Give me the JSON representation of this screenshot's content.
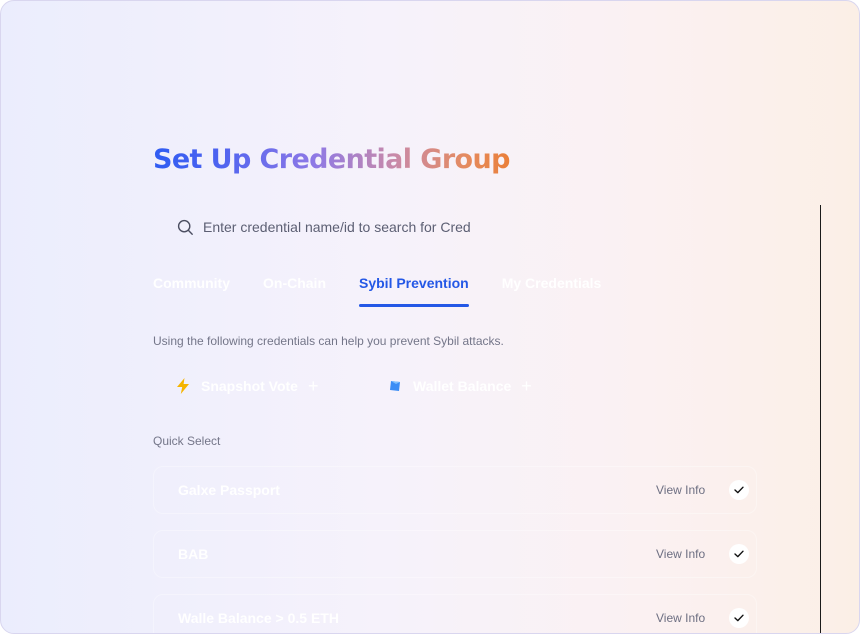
{
  "page": {
    "title": "Set Up Credential Group"
  },
  "search": {
    "placeholder": "Enter credential name/id to search for Cred"
  },
  "tabs": [
    {
      "label": "Community",
      "active": false
    },
    {
      "label": "On-Chain",
      "active": false
    },
    {
      "label": "Sybil Prevention",
      "active": true
    },
    {
      "label": "My Credentials",
      "active": false
    }
  ],
  "description": "Using the following credentials can help you prevent Sybil attacks.",
  "suggested": [
    {
      "label": "Snapshot Vote",
      "icon": "lightning-icon",
      "plus": "+"
    },
    {
      "label": "Wallet Balance",
      "icon": "cube-icon",
      "plus": "+"
    }
  ],
  "quick_select": {
    "label": "Quick Select",
    "items": [
      {
        "name": "Galxe Passport",
        "action": "View Info",
        "checked": true
      },
      {
        "name": "BAB",
        "action": "View Info",
        "checked": true
      },
      {
        "name": "Walle Balance > 0.5 ETH",
        "action": "View Info",
        "checked": true
      }
    ]
  },
  "colors": {
    "accent": "#2458e6",
    "muted_text": "#747689",
    "title_gradient": [
      "#2f5cf2",
      "#8e79e6",
      "#ea7f39"
    ]
  }
}
